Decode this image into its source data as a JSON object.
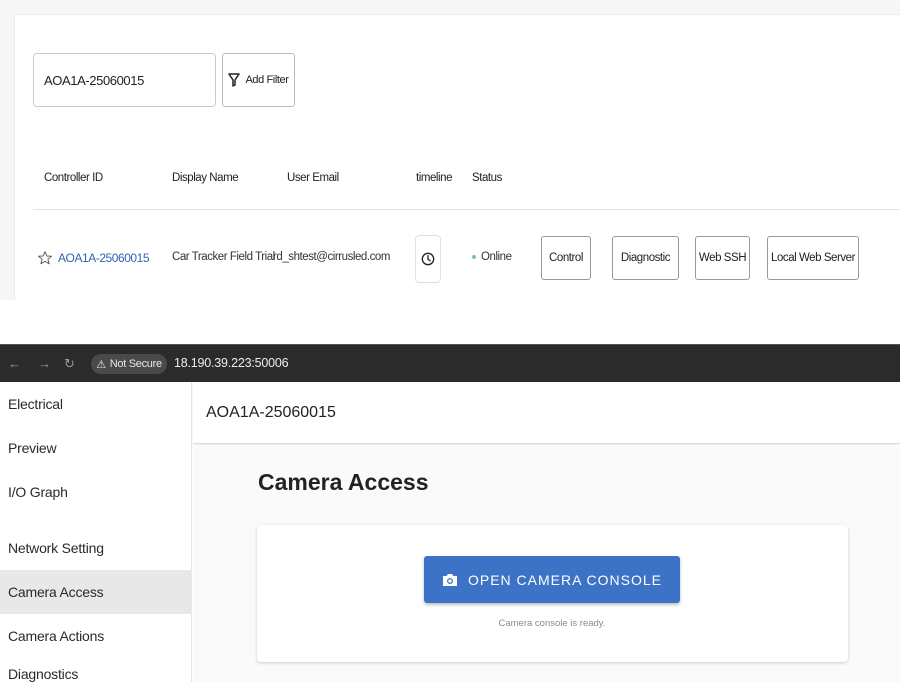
{
  "top": {
    "search_value": "AOA1A-25060015",
    "add_filter_label": "Add Filter",
    "columns": {
      "controller_id": "Controller ID",
      "display_name": "Display Name",
      "user_email": "User Email",
      "timeline": "timeline",
      "status": "Status"
    },
    "row": {
      "controller_id": "AOA1A-25060015",
      "display_name": "Car Tracker Field Trial",
      "user_email": "rd_shtest@cirrusled.com",
      "status": "Online"
    },
    "actions": {
      "control": "Control",
      "diagnostic": "Diagnostic",
      "web_ssh": "Web SSH",
      "local_web_server": "Local Web Server"
    },
    "colors": {
      "link": "#2f63b5",
      "online_dot": "#7cc4a8"
    }
  },
  "browser": {
    "security_label": "Not Secure",
    "url": "18.190.39.223:50006"
  },
  "sidebar": {
    "items": [
      {
        "label": "Electrical"
      },
      {
        "label": "Preview"
      },
      {
        "label": "I/O Graph"
      },
      {
        "label": "Network Setting"
      },
      {
        "label": "Camera Access",
        "active": true
      },
      {
        "label": "Camera Actions"
      },
      {
        "label": "Diagnostics"
      }
    ]
  },
  "app": {
    "header_title": "AOA1A-25060015",
    "page_heading": "Camera Access",
    "console_button": "OPEN CAMERA CONSOLE",
    "console_status": "Camera console is ready.",
    "colors": {
      "primary": "#3d73c6"
    }
  }
}
